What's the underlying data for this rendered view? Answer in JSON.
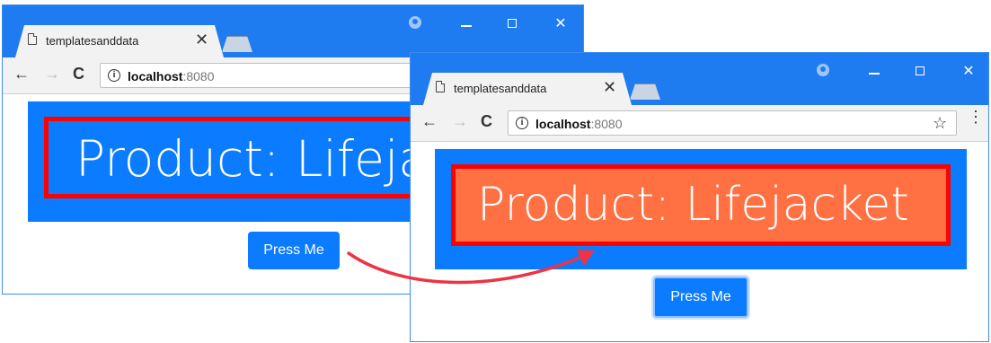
{
  "browser": {
    "tab_title": "templatesanddata",
    "tab_close": "✕",
    "url_host": "localhost",
    "url_port": ":8080",
    "back": "←",
    "forward": "→",
    "reload": "C",
    "info": "i",
    "star": "☆",
    "menu": "⋮",
    "window_close": "✕"
  },
  "page": {
    "product_text": "Product: Lifejacket",
    "button_label": "Press Me"
  },
  "colors": {
    "titlebar": "#1e7bf0",
    "content_blue": "#0b7bff",
    "highlight_border": "#ff0000",
    "highlight_fill_after": "#ff7043",
    "arrow": "#ee3344"
  }
}
